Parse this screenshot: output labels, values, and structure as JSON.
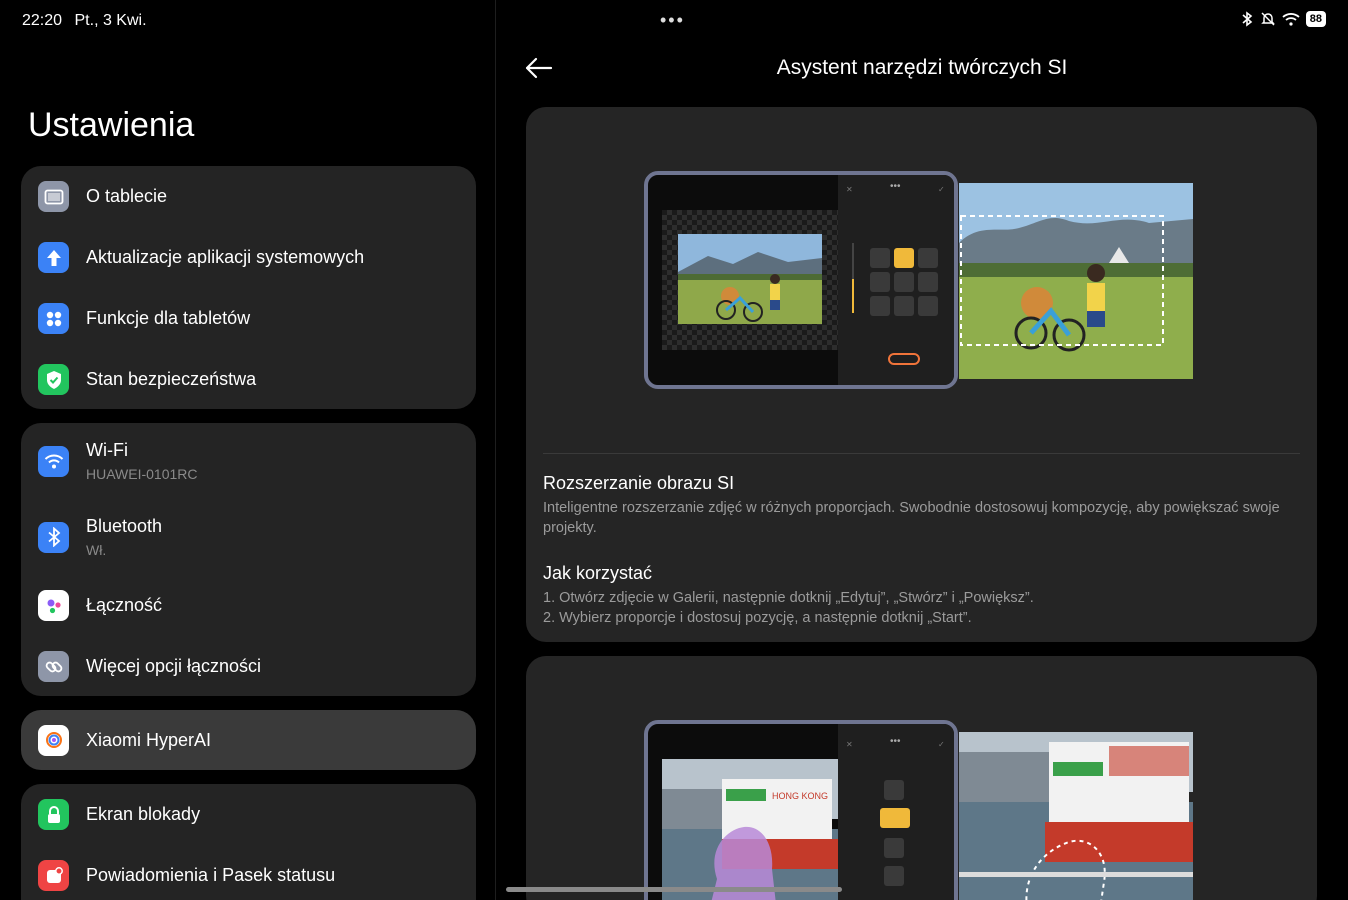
{
  "status_bar": {
    "time": "22:20",
    "date": "Pt., 3 Kwi.",
    "battery": "88"
  },
  "settings": {
    "title": "Ustawienia",
    "groups": [
      {
        "items": [
          {
            "label": "O tablecie",
            "icon": "tablet-icon",
            "color": "#8e96a8"
          },
          {
            "label": "Aktualizacje aplikacji systemowych",
            "icon": "arrow-up-icon",
            "color": "#3b82f6"
          },
          {
            "label": "Funkcje dla tabletów",
            "icon": "grid-dots-icon",
            "color": "#3b82f6"
          },
          {
            "label": "Stan bezpieczeństwa",
            "icon": "shield-check-icon",
            "color": "#22c55e"
          }
        ]
      },
      {
        "items": [
          {
            "label": "Wi-Fi",
            "sub": "HUAWEI-0101RC",
            "icon": "wifi-icon",
            "color": "#3b82f6"
          },
          {
            "label": "Bluetooth",
            "sub": "Wł.",
            "icon": "bluetooth-icon",
            "color": "#3b82f6"
          },
          {
            "label": "Łączność",
            "icon": "dots-color-icon",
            "color": "#ffffff"
          },
          {
            "label": "Więcej opcji łączności",
            "icon": "link-icon",
            "color": "#8e96a8"
          }
        ]
      },
      {
        "items": [
          {
            "label": "Xiaomi HyperAI",
            "icon": "hyperai-icon",
            "color": "#ffffff",
            "selected": true
          }
        ]
      },
      {
        "items": [
          {
            "label": "Ekran blokady",
            "icon": "lock-icon",
            "color": "#22c55e"
          },
          {
            "label": "Powiadomienia i Pasek statusu",
            "icon": "notification-icon",
            "color": "#ef4444"
          }
        ]
      }
    ]
  },
  "detail": {
    "title": "Asystent narzędzi twórczych SI",
    "card1": {
      "heading": "Rozszerzanie obrazu SI",
      "description": "Inteligentne rozszerzanie zdjęć w różnych proporcjach. Swobodnie dostosowuj kompozycję, aby powiększać swoje projekty.",
      "howto_heading": "Jak korzystać",
      "steps": [
        "1. Otwórz zdjęcie w Galerii, następnie dotknij „Edytuj”, „Stwórz” i „Powiększ”.",
        "2. Wybierz proporcje i dostosuj pozycję, a następnie dotknij „Start”."
      ]
    },
    "card2": {
      "ferry_sign": "HONG KONG"
    }
  },
  "colors": {
    "accent": "#f0b93a",
    "card_bg": "#252525",
    "group_bg": "#242424"
  }
}
